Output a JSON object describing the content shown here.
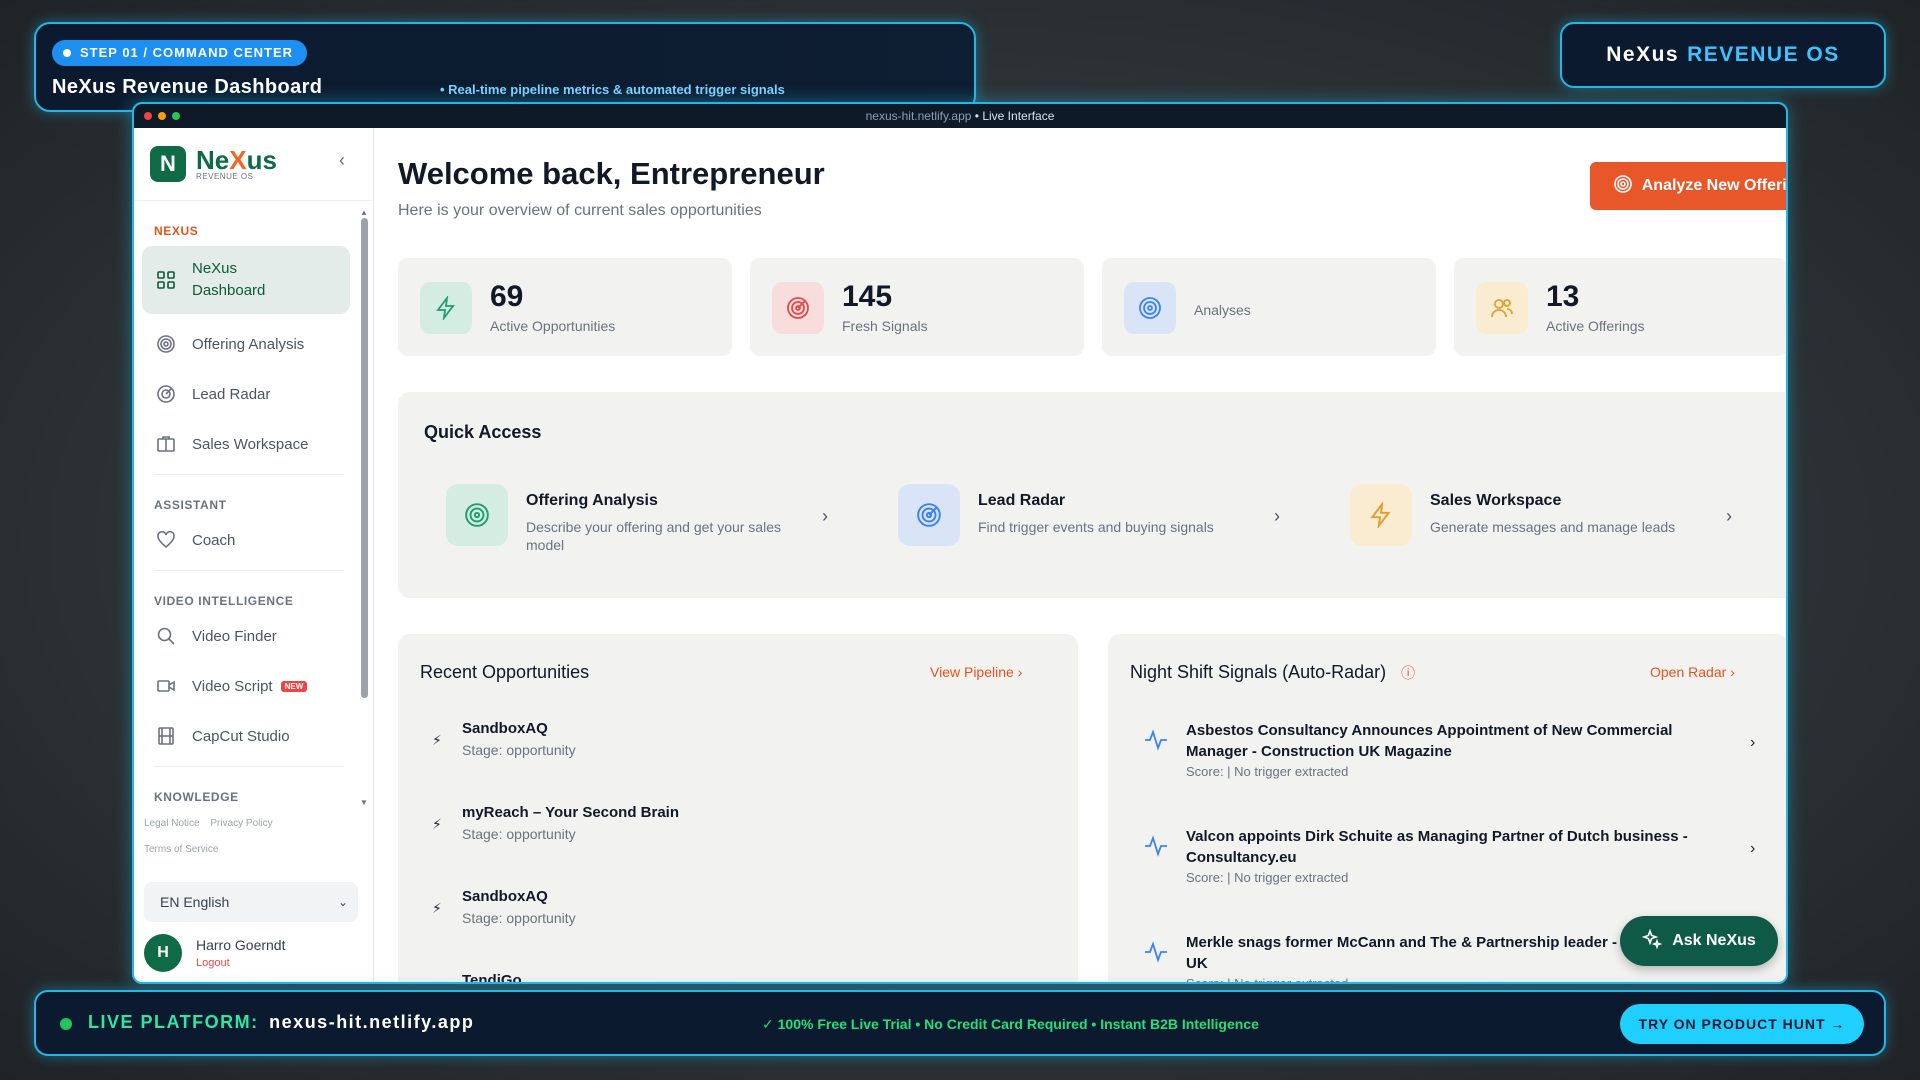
{
  "banner": {
    "step": "STEP 01 / COMMAND CENTER",
    "title": "NeXus Revenue Dashboard",
    "subtitle": "• Real-time pipeline metrics & automated trigger signals"
  },
  "brand": {
    "name": "NeXus",
    "accent": "REVENUE OS"
  },
  "window": {
    "url": "nexus-hit.netlify.app",
    "live": "• Live Interface"
  },
  "sidebar": {
    "logo_name": "NeXus",
    "logo_sub": "REVENUE OS",
    "sections": {
      "nexus": "NEXUS",
      "assistant": "ASSISTANT",
      "video": "VIDEO INTELLIGENCE",
      "knowledge": "KNOWLEDGE"
    },
    "items": [
      {
        "label": "NeXus Dashboard",
        "icon": "dashboard-icon"
      },
      {
        "label": "Offering Analysis",
        "icon": "target-icon"
      },
      {
        "label": "Lead Radar",
        "icon": "radar-icon"
      },
      {
        "label": "Sales Workspace",
        "icon": "briefcase-icon"
      },
      {
        "label": "Coach",
        "icon": "heart-icon"
      },
      {
        "label": "Video Finder",
        "icon": "search-icon"
      },
      {
        "label": "Video Script",
        "icon": "video-icon",
        "badge": "NEW"
      },
      {
        "label": "CapCut Studio",
        "icon": "film-icon"
      }
    ],
    "legal": [
      "Legal Notice",
      "Privacy Policy",
      "Terms of Service"
    ],
    "language": "EN English",
    "user": {
      "initial": "H",
      "name": "Harro Goerndt",
      "logout": "Logout"
    }
  },
  "main": {
    "welcome": "Welcome back, Entrepreneur",
    "welcome_sub": "Here is your overview of current sales opportunities",
    "analyze_button": "Analyze New Offering",
    "stats": [
      {
        "value": "69",
        "label": "Active Opportunities"
      },
      {
        "value": "145",
        "label": "Fresh Signals"
      },
      {
        "value": "",
        "label": "Analyses"
      },
      {
        "value": "13",
        "label": "Active Offerings"
      }
    ],
    "quick_access": {
      "title": "Quick Access",
      "items": [
        {
          "name": "Offering Analysis",
          "desc": "Describe your offering and get your sales model"
        },
        {
          "name": "Lead Radar",
          "desc": "Find trigger events and buying signals"
        },
        {
          "name": "Sales Workspace",
          "desc": "Generate messages and manage leads"
        }
      ]
    },
    "recent": {
      "title": "Recent Opportunities",
      "link": "View Pipeline",
      "items": [
        {
          "name": "SandboxAQ",
          "stage": "Stage: opportunity"
        },
        {
          "name": "myReach – Your Second Brain",
          "stage": "Stage: opportunity"
        },
        {
          "name": "SandboxAQ",
          "stage": "Stage: opportunity"
        },
        {
          "name": "TendiGo",
          "stage": ""
        }
      ]
    },
    "signals": {
      "title": "Night Shift Signals (Auto-Radar)",
      "link": "Open Radar",
      "items": [
        {
          "title": "Asbestos Consultancy Announces Appointment of New Commercial Manager - Construction UK Magazine",
          "score": "Score: | No trigger extracted"
        },
        {
          "title": "Valcon appoints Dirk Schuite as Managing Partner of Dutch business - Consultancy.eu",
          "score": "Score: | No trigger extracted"
        },
        {
          "title": "Merkle snags former McCann and The & Partnership leader - Campaign UK",
          "score": "Score: | No trigger extracted"
        }
      ]
    },
    "ask_button": "Ask NeXus"
  },
  "bottom": {
    "live_label": "LIVE PLATFORM:",
    "live_url": "nexus-hit.netlify.app",
    "middle": "✓ 100% Free Live Trial • No Credit Card Required • Instant B2B Intelligence",
    "cta": "TRY ON PRODUCT HUNT →"
  },
  "colors": {
    "accent_orange": "#e8572a",
    "brand_green": "#0e6b45",
    "neon_cyan": "#22b7e6"
  }
}
